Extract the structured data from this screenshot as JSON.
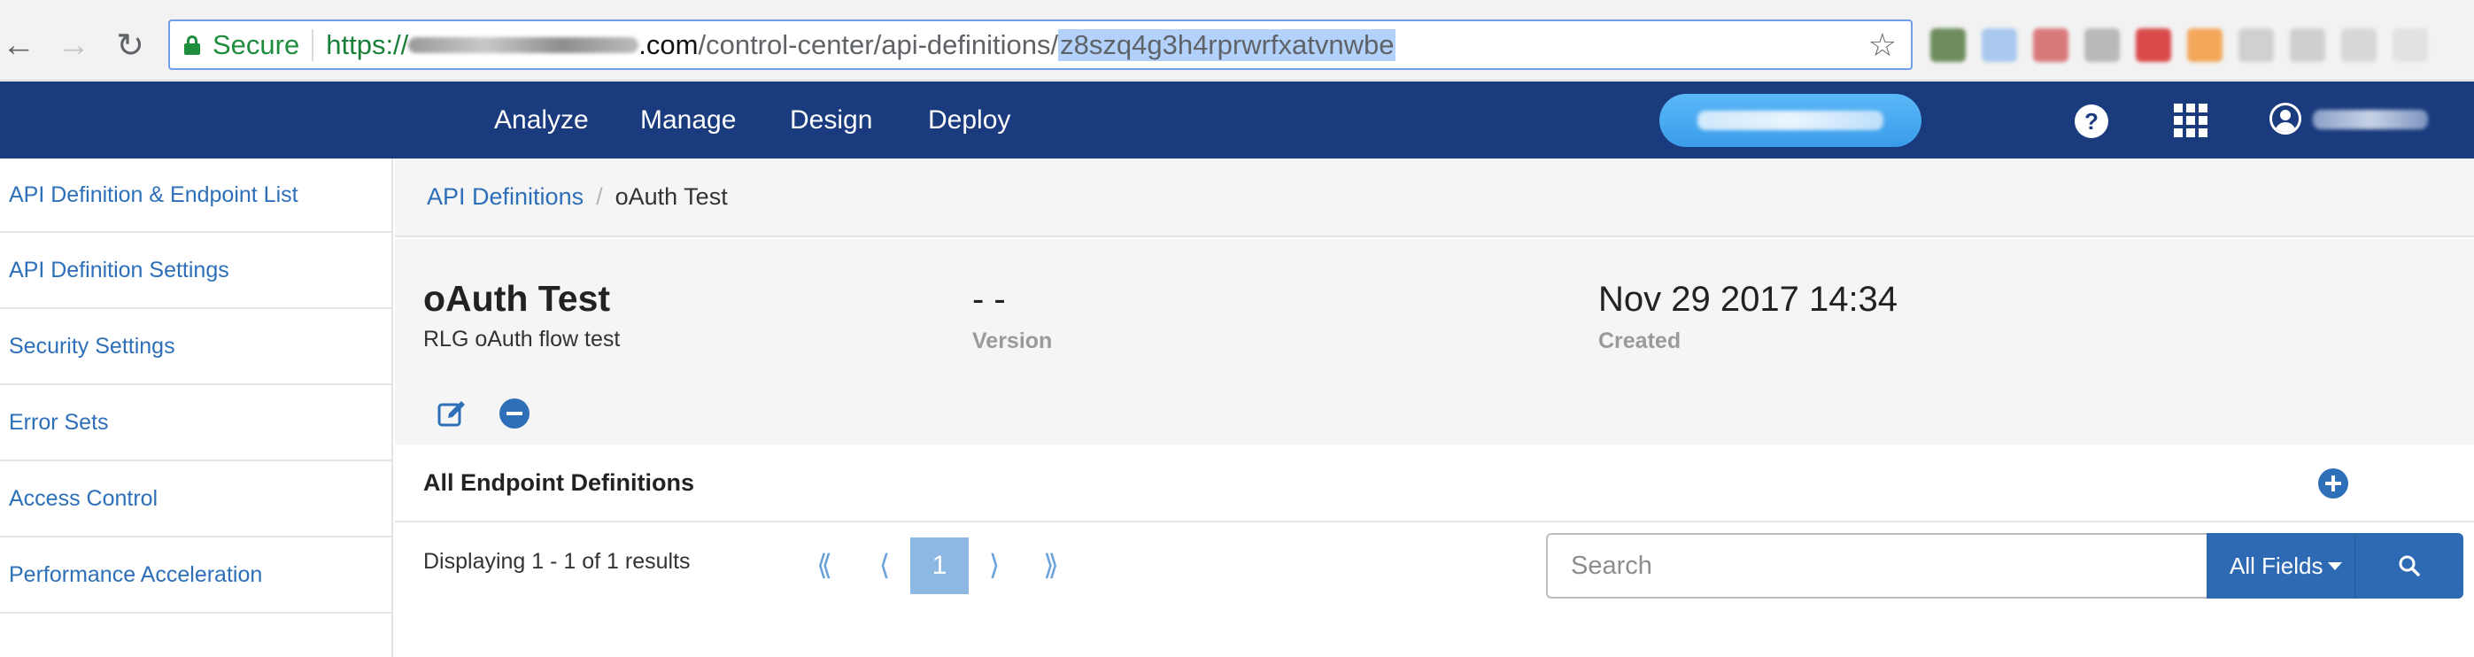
{
  "browser": {
    "secure_label": "Secure",
    "url": {
      "protocol": "https://",
      "host_suffix": ".com",
      "path": "/control-center/api-definitions/",
      "selected": "z8szq4g3h4rprwrfxatvnwbe"
    },
    "icons": {
      "back": "back-arrow-icon",
      "forward": "forward-arrow-icon",
      "reload": "reload-icon",
      "lock": "lock-icon",
      "star": "star-icon"
    },
    "extension_colors": [
      "#6e8c5e",
      "#a9c8ee",
      "#d97a7a",
      "#b9b9b9",
      "#d94a4a",
      "#f3a75a",
      "#d0d0d0",
      "#cfcfcf",
      "#d7d7d7",
      "#e2e2e2"
    ]
  },
  "appbar": {
    "background": "#1a3b7d",
    "menu": [
      "Analyze",
      "Manage",
      "Design",
      "Deploy"
    ],
    "pill_color": "#44a5ef",
    "icons": {
      "help": "help-icon",
      "apps": "apps-grid-icon",
      "user": "user-icon"
    },
    "help_glyph": "?"
  },
  "sidebar": {
    "items": [
      {
        "label": "API Definition & Endpoint List"
      },
      {
        "label": "API Definition Settings"
      },
      {
        "label": "Security Settings"
      },
      {
        "label": "Error Sets"
      },
      {
        "label": "Access Control"
      },
      {
        "label": "Performance Acceleration"
      }
    ]
  },
  "breadcrumb": {
    "parent": "API Definitions",
    "separator": "/",
    "current": "oAuth Test"
  },
  "api": {
    "title": "oAuth Test",
    "description": "RLG oAuth flow test",
    "version_value": "- -",
    "version_label": "Version",
    "created_value": "Nov 29 2017 14:34",
    "created_label": "Created",
    "icons": {
      "edit": "edit-icon",
      "remove": "remove-icon"
    }
  },
  "endpoints": {
    "title": "All Endpoint Definitions",
    "add_icon": "add-circle-icon",
    "display_text": "Displaying 1 - 1 of 1 results",
    "pagination": {
      "first": "⟪",
      "prev": "⟨",
      "current": "1",
      "next": "⟩",
      "last": "⟫"
    },
    "search": {
      "placeholder": "Search",
      "value": "",
      "fields_label": "All Fields",
      "search_icon": "search-icon"
    }
  },
  "colors": {
    "link": "#2d6fb8",
    "accent_button": "#2e6ab4",
    "page_active": "#8cb8e3",
    "panel_bg": "#f5f5f5"
  }
}
